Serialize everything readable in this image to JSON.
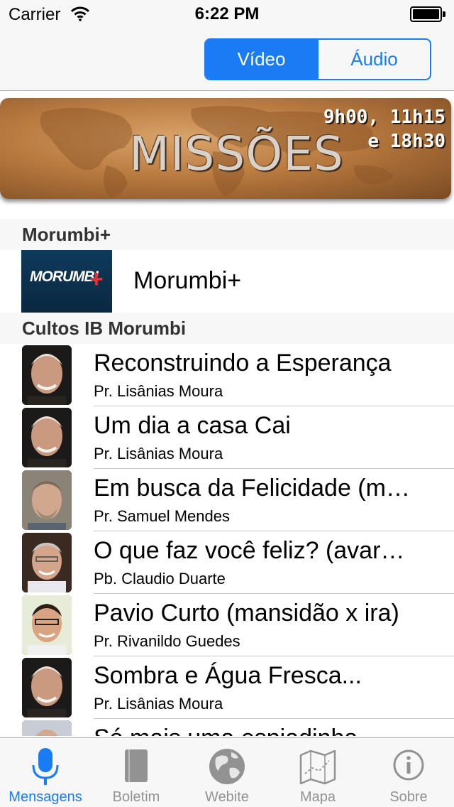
{
  "status_bar": {
    "carrier": "Carrier",
    "time": "6:22 PM"
  },
  "segmented_control": {
    "options": [
      "Vídeo",
      "Áudio"
    ],
    "selected": "Vídeo"
  },
  "banner": {
    "title": "MISSÕES",
    "times_line1": "9h00, 11h15",
    "times_line2": "e 18h30"
  },
  "sections": [
    {
      "header": "Morumbi+",
      "items": [
        {
          "title": "Morumbi+",
          "thumbnail_text": "MORUMBI",
          "thumbnail_plus": "+"
        }
      ]
    },
    {
      "header": "Cultos IB Morumbi"
    }
  ],
  "sermons": [
    {
      "title": "Reconstruindo a Esperança",
      "speaker": "Pr. Lisânias Moura"
    },
    {
      "title": "Um dia a casa Cai",
      "speaker": "Pr. Lisânias Moura"
    },
    {
      "title": "Em busca da Felicidade (m…",
      "speaker": "Pr. Samuel Mendes"
    },
    {
      "title": "O que faz você feliz? (avar…",
      "speaker": "Pb. Claudio Duarte"
    },
    {
      "title": "Pavio Curto (mansidão x ira)",
      "speaker": "Pr. Rivanildo Guedes"
    },
    {
      "title": "Sombra e Água Fresca...",
      "speaker": "Pr. Lisânias Moura"
    },
    {
      "title": "Só mais uma espiadinha...",
      "speaker": ""
    }
  ],
  "tab_bar": {
    "items": [
      {
        "label": "Mensagens",
        "icon": "microphone-icon"
      },
      {
        "label": "Boletim",
        "icon": "book-icon"
      },
      {
        "label": "Webite",
        "icon": "globe-icon"
      },
      {
        "label": "Mapa",
        "icon": "map-icon"
      },
      {
        "label": "Sobre",
        "icon": "info-icon"
      }
    ],
    "selected": "Mensagens"
  },
  "colors": {
    "accent": "#1a7cf5",
    "bar_background": "#f7f7f7",
    "inactive_tab": "#929292"
  }
}
